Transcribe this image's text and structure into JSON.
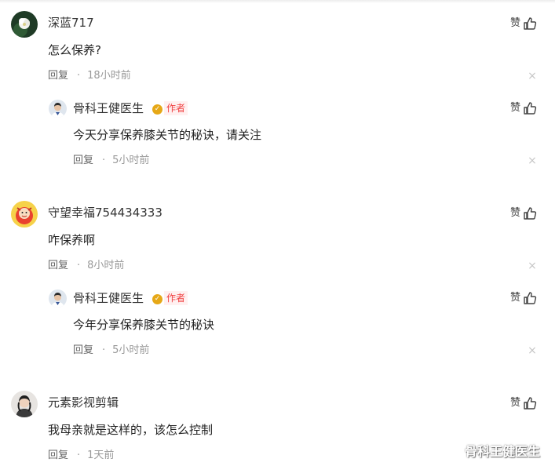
{
  "comments": [
    {
      "user": "深蓝717",
      "text": "怎么保养?",
      "reply_label": "回复",
      "separator": "·",
      "time": "18小时前",
      "like_label": "赞",
      "close_glyph": "×"
    },
    {
      "user": "守望幸福754434333",
      "text": "咋保养啊",
      "reply_label": "回复",
      "separator": "·",
      "time": "8小时前",
      "like_label": "赞",
      "close_glyph": "×"
    },
    {
      "user": "元素影视剪辑",
      "text": "我母亲就是这样的，该怎么控制",
      "reply_label": "回复",
      "separator": "·",
      "time": "1天前",
      "like_label": "赞"
    }
  ],
  "replies": [
    {
      "user": "骨科王健医生",
      "verified_glyph": "✓",
      "author_tag": "作者",
      "text": "今天分享保养膝关节的秘诀，请关注",
      "reply_label": "回复",
      "separator": "·",
      "time": "5小时前",
      "like_label": "赞",
      "close_glyph": "×"
    },
    {
      "user": "骨科王健医生",
      "verified_glyph": "✓",
      "author_tag": "作者",
      "text": "今年分享保养膝关节的秘诀",
      "reply_label": "回复",
      "separator": "·",
      "time": "5小时前",
      "like_label": "赞",
      "close_glyph": "×"
    }
  ],
  "watermark": "骨科王健医生",
  "colors": {
    "author_tag": "#f04142",
    "verified": "#e6a817",
    "meta_text": "#999999"
  },
  "icons": {
    "like": "thumbs-up-icon",
    "dismiss": "close-icon",
    "verified": "verified-badge-icon"
  }
}
